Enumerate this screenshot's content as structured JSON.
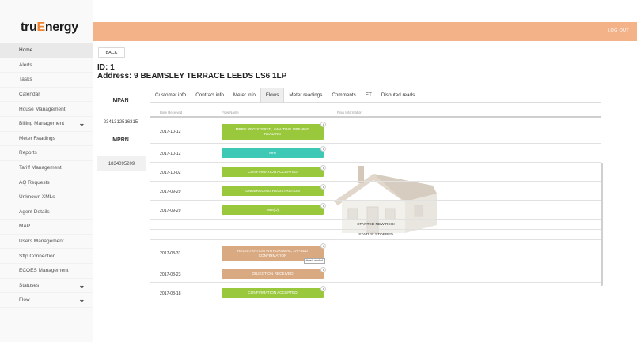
{
  "brand": {
    "logo_part1": "tru",
    "logo_part2": "E",
    "logo_part3": "nergy",
    "accent_color": "#f0832f",
    "header_color": "#f4b288"
  },
  "header": {
    "logout_label": "LOG OUT"
  },
  "sidebar": {
    "items": [
      {
        "label": "Home",
        "active": true
      },
      {
        "label": "Alerts"
      },
      {
        "label": "Tasks"
      },
      {
        "label": "Calendar"
      },
      {
        "label": "House Management"
      },
      {
        "label": "Billing Management",
        "chevron": true
      },
      {
        "label": "Meter Readings"
      },
      {
        "label": "Reports"
      },
      {
        "label": "Tariff Management"
      },
      {
        "label": "AQ Requests"
      },
      {
        "label": "Unknown XMLs"
      },
      {
        "label": "Agent Details"
      },
      {
        "label": "MAP"
      },
      {
        "label": "Users Management"
      },
      {
        "label": "Sftp Connection"
      },
      {
        "label": "ECOES Management"
      },
      {
        "label": "Statuses",
        "chevron": true
      },
      {
        "label": "Flow",
        "chevron": true
      }
    ]
  },
  "main": {
    "back_label": "BACK",
    "id_line": "ID: 1",
    "address_line": "Address: 9 BEAMSLEY TERRACE LEEDS LS6 1LP",
    "mpan_label": "MPAN",
    "mpan_value": "2341312516315",
    "mprn_label": "MPRN",
    "mprn_value": "1834095209"
  },
  "tabs": [
    {
      "label": "Customer info"
    },
    {
      "label": "Contract info"
    },
    {
      "label": "Meter info"
    },
    {
      "label": "Flows",
      "active": true
    },
    {
      "label": "Meter readings"
    },
    {
      "label": "Comments"
    },
    {
      "label": "ET"
    },
    {
      "label": "Disputed reads"
    }
  ],
  "table": {
    "headers": {
      "date": "Date Received",
      "flow_name": "Flow Name",
      "flow_info": "Flow Information"
    },
    "badge_icon": "info-icon",
    "rows": [
      {
        "date": "2017-10-12",
        "flow": "MPRN REGISTERED, AWAITING OPENING READING",
        "color": "green"
      },
      {
        "date": "2017-10-12",
        "flow": "MRI",
        "color": "teal"
      },
      {
        "date": "2017-10-02",
        "flow": "CONFIRMATION ACCEPTED",
        "color": "green"
      },
      {
        "date": "2017-09-29",
        "flow": "UNDERGOING REGISTRATION",
        "color": "green"
      },
      {
        "date": "2017-09-29",
        "flow": "MRI(D)",
        "color": "green"
      },
      {
        "text": "STARTED NEW REGI"
      },
      {
        "text": "STATUS: STOPPED"
      },
      {
        "date": "2017-08-31",
        "flow": "REGISTRATION WITHDRAWAL, LAPSED CONFIRMATION",
        "color": "tan",
        "tooltip": "time's ended"
      },
      {
        "date": "2017-08-23",
        "flow": "OBJECTION RECEIVED",
        "color": "tan"
      },
      {
        "date": "2017-08-18",
        "flow": "CONFIRMATION ACCEPTED",
        "color": "green"
      }
    ]
  },
  "colors": {
    "green": "#9ac83c",
    "teal": "#3ec9b7",
    "tan": "#d9a981"
  }
}
